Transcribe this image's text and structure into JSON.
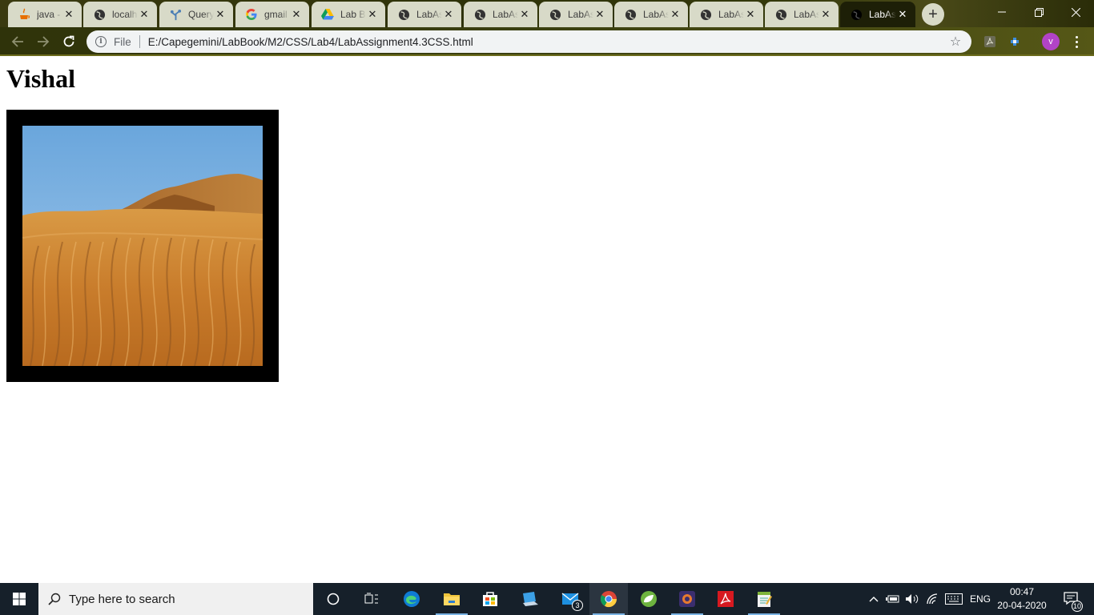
{
  "browser": {
    "tabs": [
      {
        "label": "java -",
        "icon": "java-icon",
        "active": false
      },
      {
        "label": "localh",
        "icon": "globe-icon",
        "active": false
      },
      {
        "label": "Query",
        "icon": "tree-icon",
        "active": false
      },
      {
        "label": "gmail",
        "icon": "google-icon",
        "active": false
      },
      {
        "label": "Lab B",
        "icon": "drive-icon",
        "active": false
      },
      {
        "label": "LabAs",
        "icon": "globe-icon",
        "active": false
      },
      {
        "label": "LabAs",
        "icon": "globe-icon",
        "active": false
      },
      {
        "label": "LabAs",
        "icon": "globe-icon",
        "active": false
      },
      {
        "label": "LabAs",
        "icon": "globe-icon",
        "active": false
      },
      {
        "label": "LabAs",
        "icon": "globe-icon",
        "active": false
      },
      {
        "label": "LabAs",
        "icon": "globe-icon",
        "active": false
      },
      {
        "label": "LabAs",
        "icon": "globe-icon",
        "active": true
      }
    ],
    "address_bar": {
      "scheme_label": "File",
      "url": "E:/Capegemini/LabBook/M2/CSS/Lab4/LabAssignment4.3CSS.html"
    },
    "profile_initial": "v"
  },
  "page": {
    "heading": "Vishal",
    "image": {
      "subject": "desert sand dunes",
      "frame_color": "#000000"
    }
  },
  "taskbar": {
    "search_placeholder": "Type here to search",
    "mail_badge": "3",
    "language": "ENG",
    "time": "00:47",
    "date": "20-04-2020",
    "notification_count": "10"
  },
  "colors": {
    "titlebar": "#2e3208",
    "active_tab": "#1d1f07",
    "inactive_tab": "#d8dac8",
    "taskbar": "#16202a",
    "avatar": "#b243c6"
  }
}
